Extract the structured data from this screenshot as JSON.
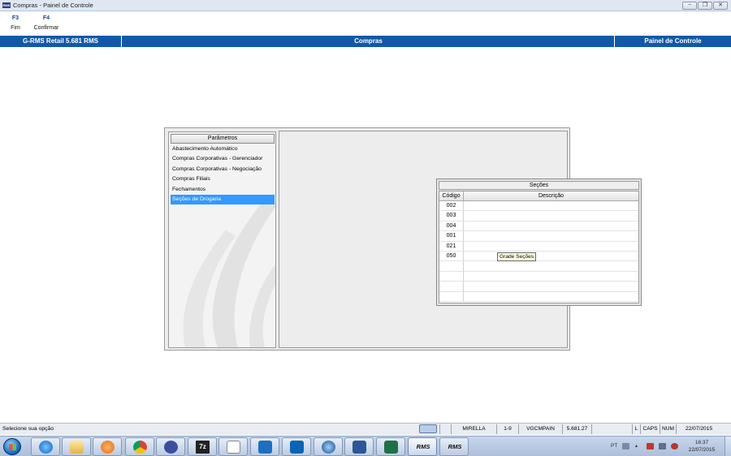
{
  "window": {
    "title": "Compras - Painel de Controle",
    "app_icon_text": "RMS",
    "minimize_glyph": "−",
    "maximize_glyph": "❐",
    "close_glyph": "✕"
  },
  "toolbar": {
    "f3_key": "F3",
    "f3_label": "Fim",
    "f4_key": "F4",
    "f4_label": "Confirmar"
  },
  "header": {
    "left": "G-RMS Retail 5.681 RMS",
    "center": "Compras",
    "right": "Painel de Controle"
  },
  "parameters": {
    "header": "Parâmetros",
    "items": [
      "Abastecimento Automático",
      "Compras Corporativas - Gerenciador",
      "Compras Corporativas - Negociação",
      "Compras Filiais",
      "Fechamentos",
      "Seções de Drogaria"
    ],
    "selected_index": 5
  },
  "sections_grid": {
    "title": "Seções",
    "col_code": "Código",
    "col_desc": "Descrição",
    "rows": [
      {
        "code": "002",
        "desc": ""
      },
      {
        "code": "003",
        "desc": ""
      },
      {
        "code": "004",
        "desc": ""
      },
      {
        "code": "001",
        "desc": ""
      },
      {
        "code": "021",
        "desc": ""
      },
      {
        "code": "050",
        "desc": ""
      },
      {
        "code": "",
        "desc": ""
      },
      {
        "code": "",
        "desc": ""
      },
      {
        "code": "",
        "desc": ""
      },
      {
        "code": "",
        "desc": ""
      }
    ],
    "tooltip": "Grade Seções"
  },
  "statusbar": {
    "message": "Selecione sua opção",
    "user": "MIRELLA",
    "range": "1-9",
    "program": "VGCMPAIN",
    "version": "5.681.27",
    "l_flag": "L",
    "caps": "CAPS",
    "num": "NUM",
    "date": "22/07/2015"
  },
  "taskbar": {
    "rms_label": "RMS",
    "seven_zip_label": "7z",
    "lang": "PT",
    "time": "16:37",
    "date": "22/07/2015"
  },
  "colors": {
    "header_blue": "#1159a8",
    "selection_blue": "#3399ff"
  }
}
